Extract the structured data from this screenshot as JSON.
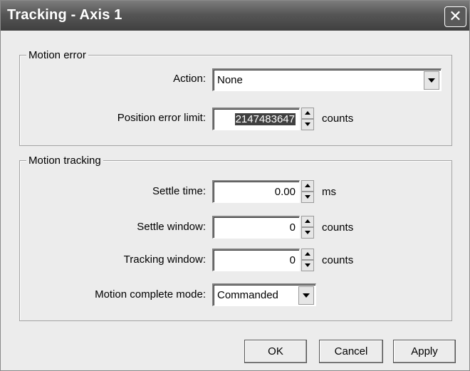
{
  "window": {
    "title": "Tracking - Axis 1",
    "close_glyph": "✕"
  },
  "motion_error": {
    "legend": "Motion error",
    "action": {
      "label": "Action:",
      "value": "None"
    },
    "position_error_limit": {
      "label": "Position error limit:",
      "value": "2147483647",
      "unit": "counts"
    }
  },
  "motion_tracking": {
    "legend": "Motion tracking",
    "settle_time": {
      "label": "Settle time:",
      "value": "0.00",
      "unit": "ms"
    },
    "settle_window": {
      "label": "Settle window:",
      "value": "0",
      "unit": "counts"
    },
    "tracking_window": {
      "label": "Tracking window:",
      "value": "0",
      "unit": "counts"
    },
    "motion_complete_mode": {
      "label": "Motion complete mode:",
      "value": "Commanded"
    }
  },
  "buttons": {
    "ok": "OK",
    "cancel": "Cancel",
    "apply": "Apply"
  }
}
